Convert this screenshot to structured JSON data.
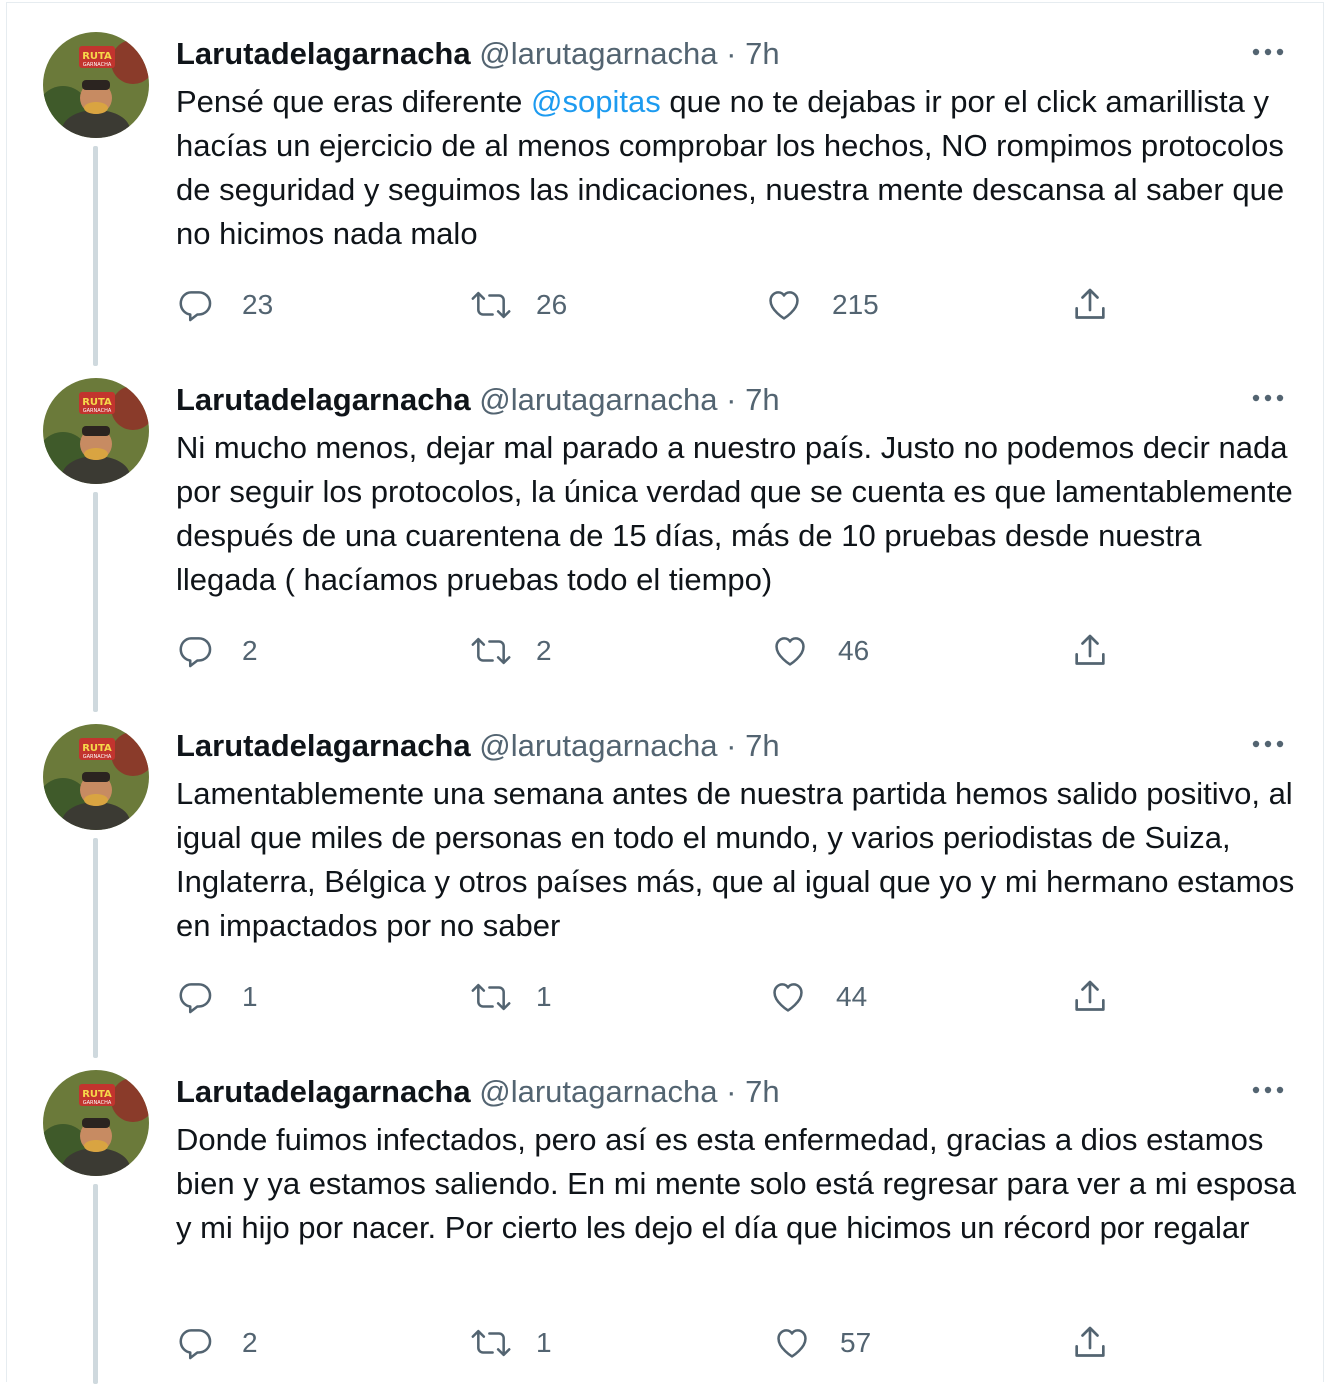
{
  "tweets": [
    {
      "name": "Larutadelagarnacha",
      "handle": "@larutagarnacha",
      "dot": "·",
      "time": "7h",
      "text_before": "Pensé que eras diferente ",
      "mention": "@sopitas",
      "text_after": " que no te dejabas ir por el click amarillista y hacías un ejercicio de al menos comprobar los hechos, NO rompimos  protocolos de seguridad y seguimos las indicaciones, nuestra mente descansa al saber que no hicimos nada malo",
      "replies": "23",
      "retweets": "26",
      "likes": "215"
    },
    {
      "name": "Larutadelagarnacha",
      "handle": "@larutagarnacha",
      "dot": "·",
      "time": "7h",
      "text_before": "Ni mucho menos, dejar mal parado a nuestro país. Justo no podemos decir nada por seguir los protocolos, la única verdad que se cuenta es que lamentablemente después de una cuarentena de 15 días, más de 10 pruebas desde nuestra llegada ( hacíamos pruebas todo el tiempo)",
      "mention": "",
      "text_after": "",
      "replies": "2",
      "retweets": "2",
      "likes": "46"
    },
    {
      "name": "Larutadelagarnacha",
      "handle": "@larutagarnacha",
      "dot": "·",
      "time": "7h",
      "text_before": "Lamentablemente una semana antes de nuestra partida hemos salido positivo, al igual que miles de personas en todo el mundo, y varios periodistas de Suiza, Inglaterra, Bélgica y otros países más, que al igual que yo y mi hermano estamos en impactados por no saber",
      "mention": "",
      "text_after": "",
      "replies": "1",
      "retweets": "1",
      "likes": "44"
    },
    {
      "name": "Larutadelagarnacha",
      "handle": "@larutagarnacha",
      "dot": "·",
      "time": "7h",
      "text_before": "Donde fuimos infectados, pero así es esta enfermedad, gracias a dios estamos bien y ya estamos saliendo. En mi mente solo está regresar para ver a mi esposa y mi hijo por nacer. Por cierto les dejo el día que hicimos un récord por regalar",
      "mention": "",
      "text_after": "",
      "replies": "2",
      "retweets": "1",
      "likes": "57"
    }
  ],
  "avatar_text": {
    "line1": "RUTA",
    "line2": "GARNACHA"
  },
  "icons": {
    "reply": "reply-icon",
    "retweet": "retweet-icon",
    "like": "like-icon",
    "share": "share-icon",
    "more": "more-icon"
  },
  "colors": {
    "text": "#0f1419",
    "secondary": "#536471",
    "link": "#1d9bf0",
    "thread_line": "#cfd9de",
    "border": "#e6ecf0"
  }
}
